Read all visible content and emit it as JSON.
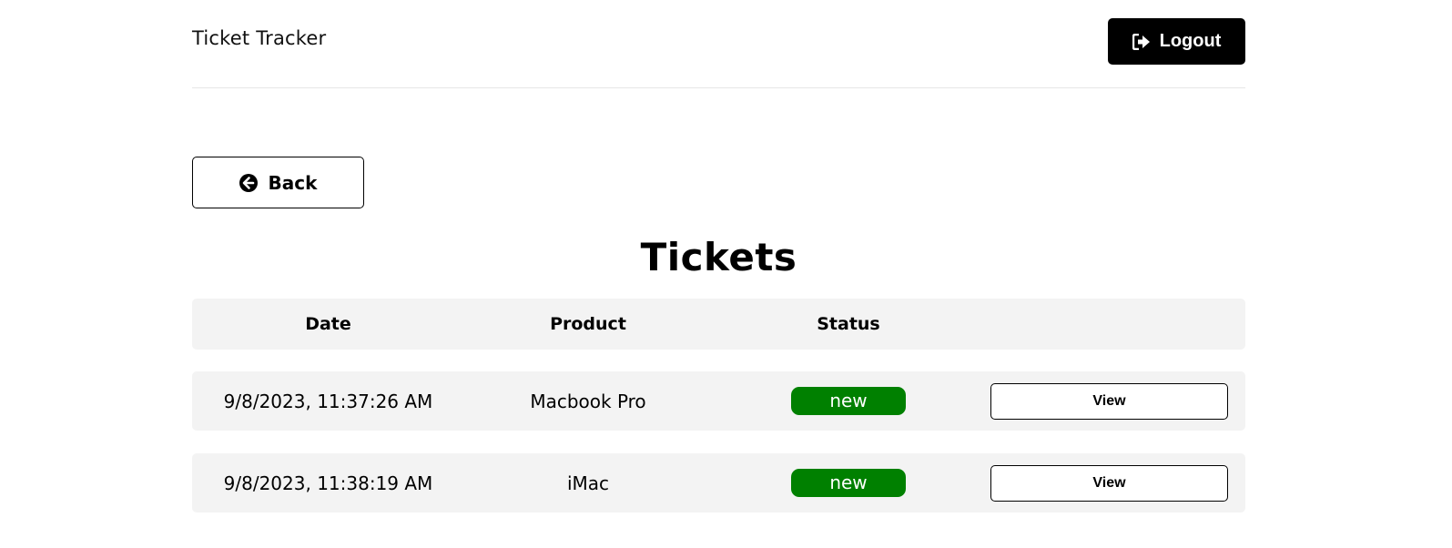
{
  "header": {
    "brand": "Ticket Tracker",
    "logout_label": "Logout",
    "logout_icon": "sign-out-icon"
  },
  "back": {
    "label": "Back",
    "icon": "arrow-circle-left-icon"
  },
  "page": {
    "title": "Tickets"
  },
  "table": {
    "columns": [
      "Date",
      "Product",
      "Status",
      ""
    ],
    "rows": [
      {
        "date": "9/8/2023, 11:37:26 AM",
        "product": "Macbook Pro",
        "status": "new",
        "action": "View"
      },
      {
        "date": "9/8/2023, 11:38:19 AM",
        "product": "iMac",
        "status": "new",
        "action": "View"
      }
    ]
  },
  "colors": {
    "status_new": "#008000",
    "row_background": "#f3f3f3",
    "primary_button": "#000000"
  }
}
